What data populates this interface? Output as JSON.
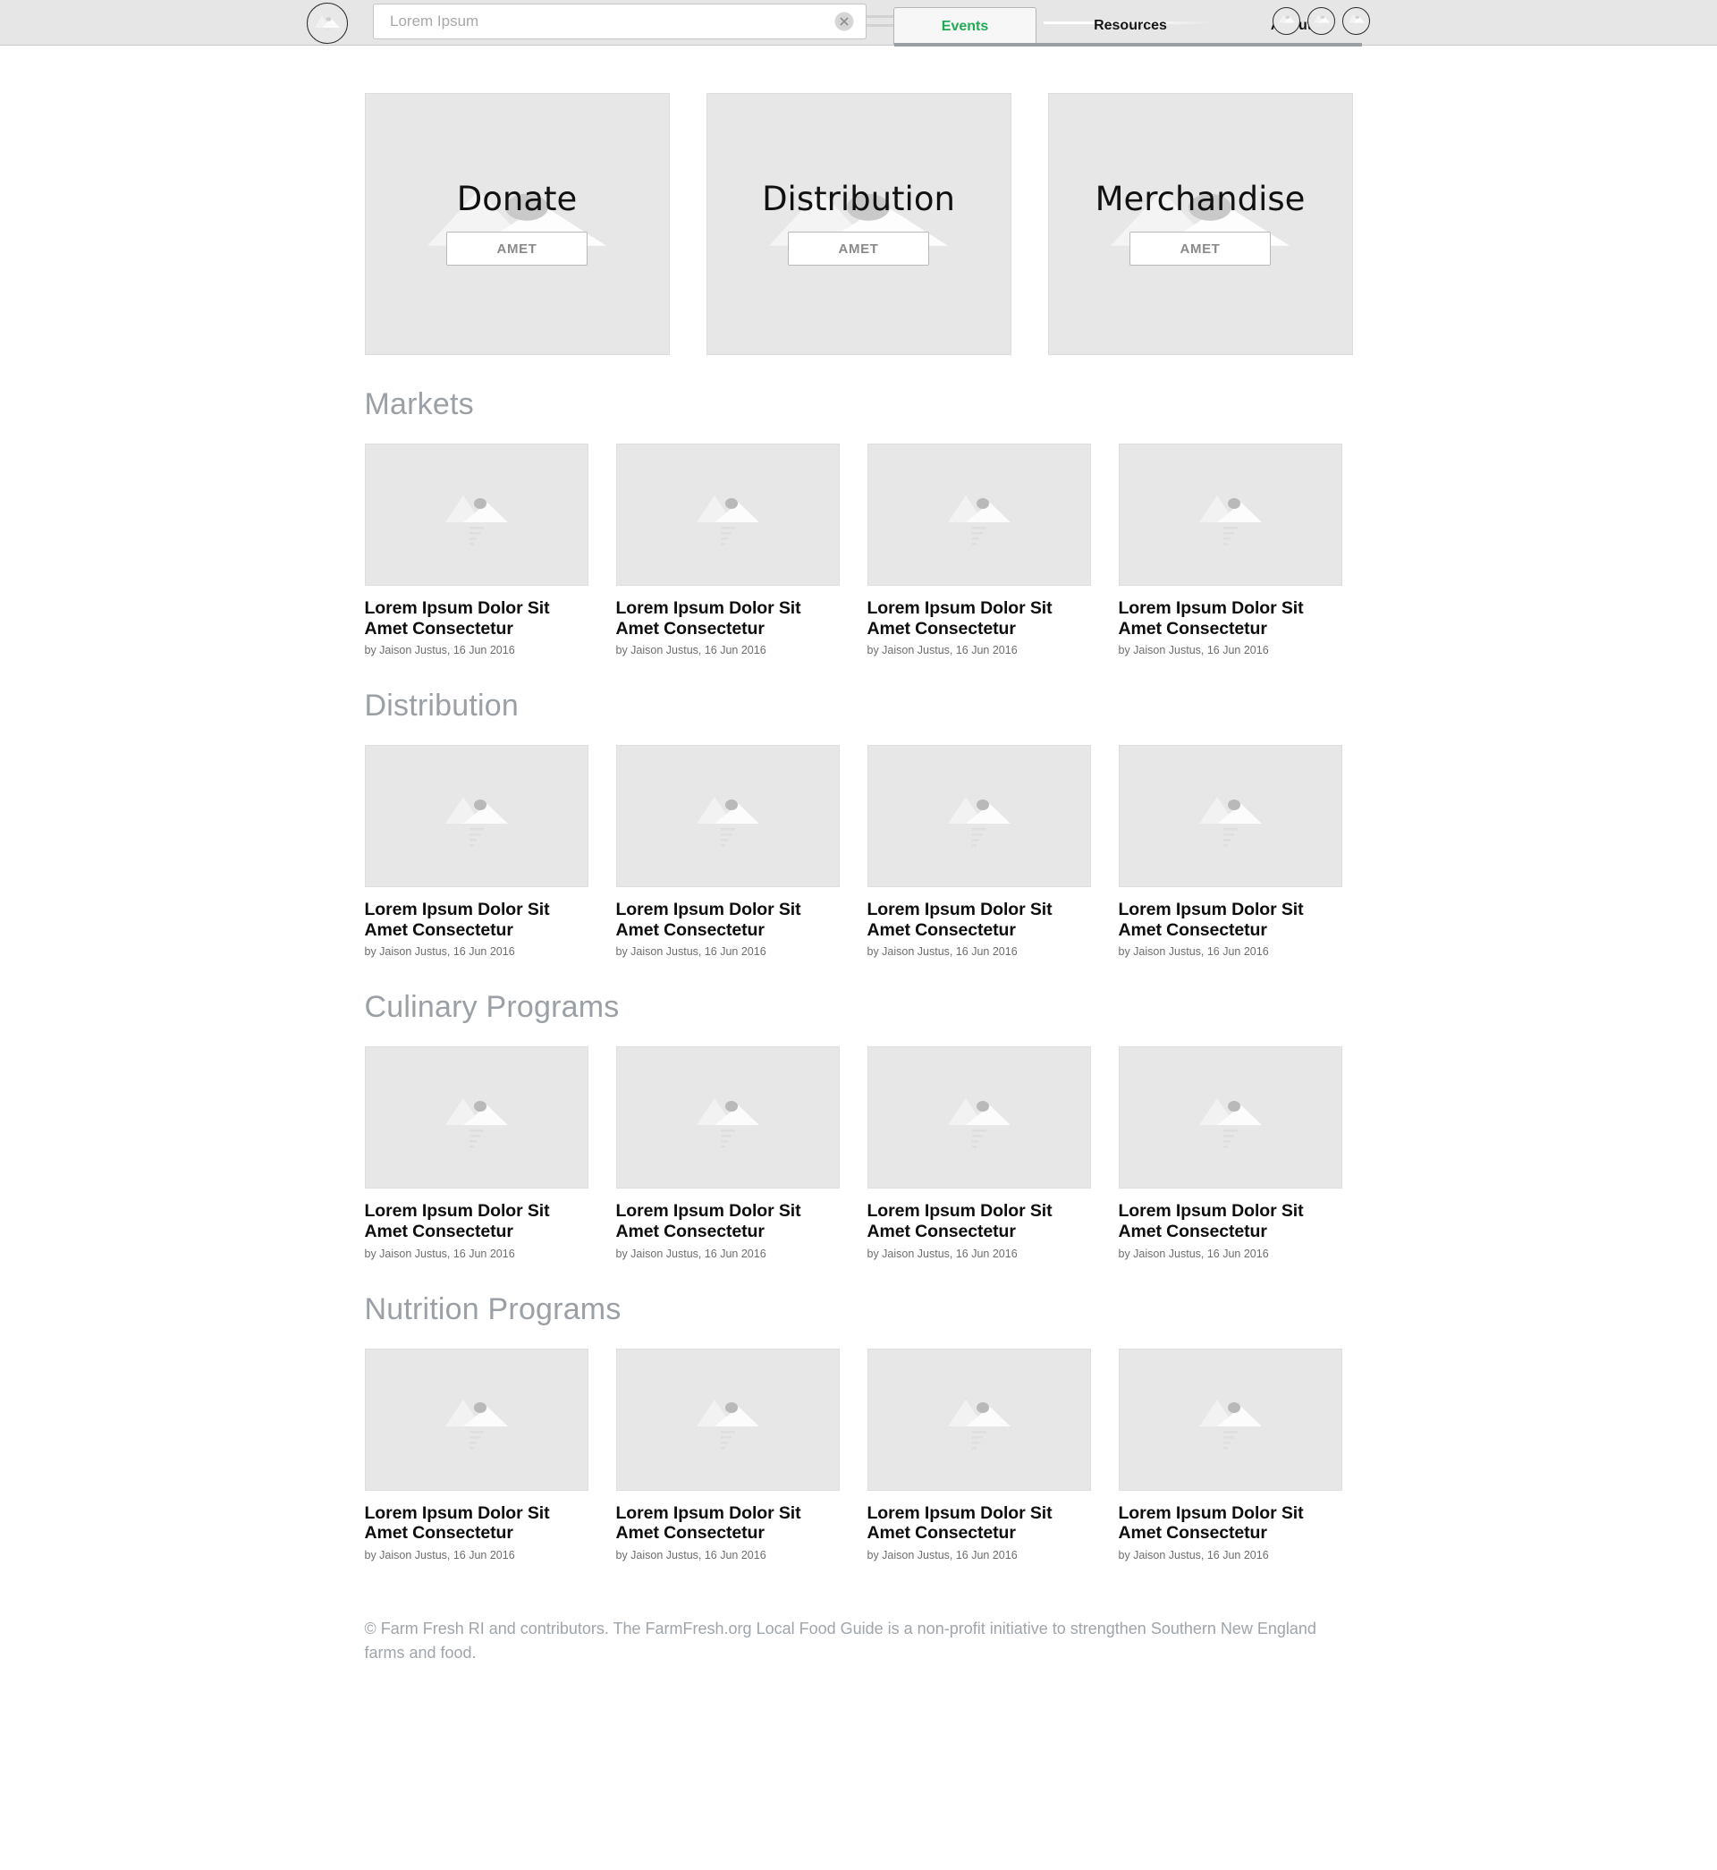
{
  "header": {
    "logo_icon": "image-placeholder-icon",
    "search": {
      "value": "",
      "placeholder": "Lorem Ipsum",
      "clear_icon": "clear-circle-x-icon"
    },
    "tabs": [
      {
        "label": "Events",
        "active": true
      },
      {
        "label": "Resources",
        "active": false
      },
      {
        "label": "About",
        "active": false
      }
    ],
    "actions": [
      {
        "icon": "image-placeholder-icon"
      },
      {
        "icon": "image-placeholder-icon"
      },
      {
        "icon": "image-placeholder-icon"
      }
    ],
    "accent_color": "#1faa53",
    "bar_color": "#e6e6e6"
  },
  "hero": {
    "cards": [
      {
        "title": "Donate",
        "button_label": "AMET",
        "placeholder_icon": "image-placeholder-icon"
      },
      {
        "title": "Distribution",
        "button_label": "AMET",
        "placeholder_icon": "image-placeholder-icon"
      },
      {
        "title": "Merchandise",
        "button_label": "AMET",
        "placeholder_icon": "image-placeholder-icon"
      }
    ]
  },
  "sections": [
    {
      "title": "Markets",
      "cards": [
        {
          "title": "Lorem Ipsum Dolor Sit Amet Consectetur",
          "byline": "by Jaison Justus, 16 Jun 2016",
          "placeholder_icon": "image-placeholder-icon"
        },
        {
          "title": "Lorem Ipsum Dolor Sit Amet Consectetur",
          "byline": "by Jaison Justus, 16 Jun 2016",
          "placeholder_icon": "image-placeholder-icon"
        },
        {
          "title": "Lorem Ipsum Dolor Sit Amet Consectetur",
          "byline": "by Jaison Justus, 16 Jun 2016",
          "placeholder_icon": "image-placeholder-icon"
        },
        {
          "title": "Lorem Ipsum Dolor Sit Amet Consectetur",
          "byline": "by Jaison Justus, 16 Jun 2016",
          "placeholder_icon": "image-placeholder-icon"
        }
      ]
    },
    {
      "title": "Distribution",
      "cards": [
        {
          "title": "Lorem Ipsum Dolor Sit Amet Consectetur",
          "byline": "by Jaison Justus, 16 Jun 2016",
          "placeholder_icon": "image-placeholder-icon"
        },
        {
          "title": "Lorem Ipsum Dolor Sit Amet Consectetur",
          "byline": "by Jaison Justus, 16 Jun 2016",
          "placeholder_icon": "image-placeholder-icon"
        },
        {
          "title": "Lorem Ipsum Dolor Sit Amet Consectetur",
          "byline": "by Jaison Justus, 16 Jun 2016",
          "placeholder_icon": "image-placeholder-icon"
        },
        {
          "title": "Lorem Ipsum Dolor Sit Amet Consectetur",
          "byline": "by Jaison Justus, 16 Jun 2016",
          "placeholder_icon": "image-placeholder-icon"
        }
      ]
    },
    {
      "title": "Culinary Programs",
      "cards": [
        {
          "title": "Lorem Ipsum Dolor Sit Amet Consectetur",
          "byline": "by Jaison Justus, 16 Jun 2016",
          "placeholder_icon": "image-placeholder-icon"
        },
        {
          "title": "Lorem Ipsum Dolor Sit Amet Consectetur",
          "byline": "by Jaison Justus, 16 Jun 2016",
          "placeholder_icon": "image-placeholder-icon"
        },
        {
          "title": "Lorem Ipsum Dolor Sit Amet Consectetur",
          "byline": "by Jaison Justus, 16 Jun 2016",
          "placeholder_icon": "image-placeholder-icon"
        },
        {
          "title": "Lorem Ipsum Dolor Sit Amet Consectetur",
          "byline": "by Jaison Justus, 16 Jun 2016",
          "placeholder_icon": "image-placeholder-icon"
        }
      ]
    },
    {
      "title": "Nutrition Programs",
      "cards": [
        {
          "title": "Lorem Ipsum Dolor Sit Amet Consectetur",
          "byline": "by Jaison Justus, 16 Jun 2016",
          "placeholder_icon": "image-placeholder-icon"
        },
        {
          "title": "Lorem Ipsum Dolor Sit Amet Consectetur",
          "byline": "by Jaison Justus, 16 Jun 2016",
          "placeholder_icon": "image-placeholder-icon"
        },
        {
          "title": "Lorem Ipsum Dolor Sit Amet Consectetur",
          "byline": "by Jaison Justus, 16 Jun 2016",
          "placeholder_icon": "image-placeholder-icon"
        },
        {
          "title": "Lorem Ipsum Dolor Sit Amet Consectetur",
          "byline": "by Jaison Justus, 16 Jun 2016",
          "placeholder_icon": "image-placeholder-icon"
        }
      ]
    }
  ],
  "footer": {
    "text": "© Farm Fresh RI and contributors. The FarmFresh.org Local Food Guide is a non-profit initiative to strengthen Southern New England farms and food."
  }
}
